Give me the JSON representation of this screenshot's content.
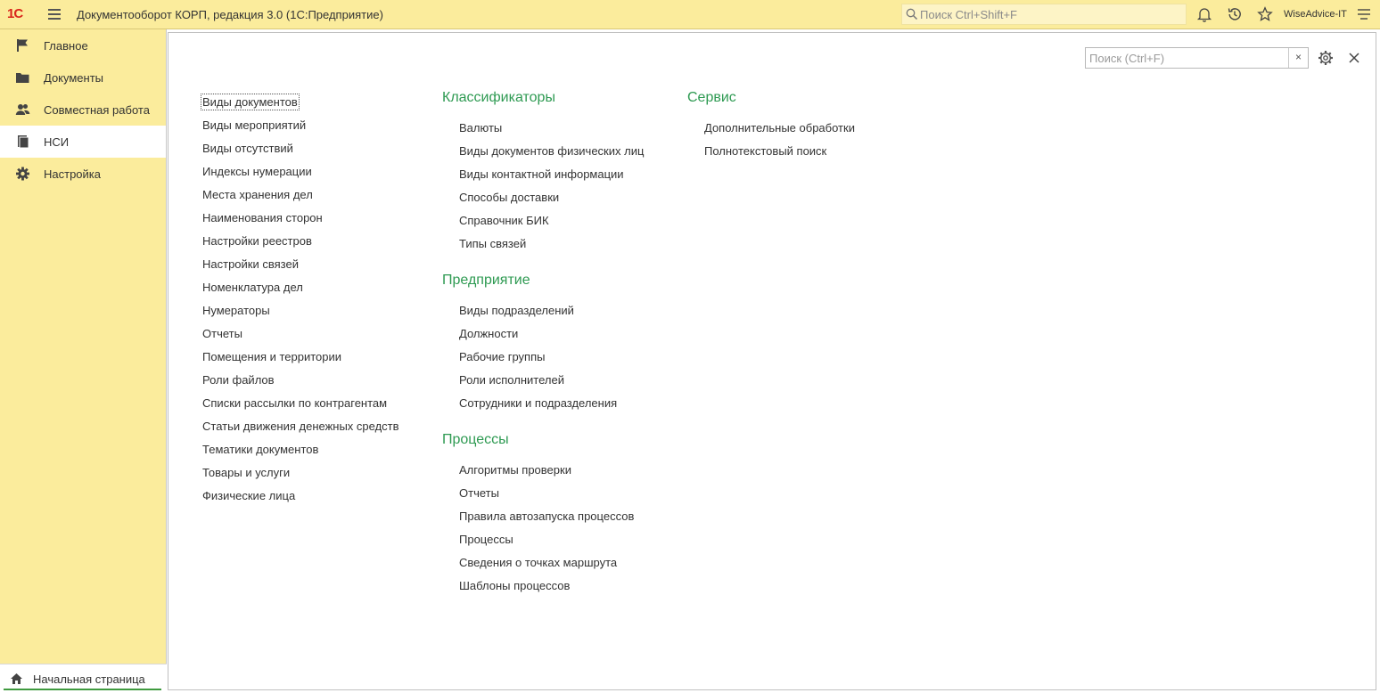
{
  "app": {
    "logo": "1С",
    "title": "Документооборот КОРП, редакция 3.0  (1С:Предприятие)",
    "search_placeholder": "Поиск Ctrl+Shift+F",
    "user": "WiseAdvice-IT"
  },
  "sidebar": {
    "items": [
      {
        "label": "Главное",
        "icon": "flag-icon"
      },
      {
        "label": "Документы",
        "icon": "folder-icon"
      },
      {
        "label": "Совместная работа",
        "icon": "users-icon"
      },
      {
        "label": "НСИ",
        "icon": "book-icon",
        "active": true
      },
      {
        "label": "Настройка",
        "icon": "gear-icon"
      }
    ],
    "home_tab": "Начальная страница"
  },
  "form": {
    "search_placeholder": "Поиск (Ctrl+F)",
    "clear_label": "×"
  },
  "columns": {
    "left": {
      "items": [
        "Виды документов",
        "Виды мероприятий",
        "Виды отсутствий",
        "Индексы нумерации",
        "Места хранения дел",
        "Наименования сторон",
        "Настройки реестров",
        "Настройки связей",
        "Номенклатура дел",
        "Нумераторы",
        "Отчеты",
        "Помещения и территории",
        "Роли файлов",
        "Списки рассылки по контрагентам",
        "Статьи движения денежных средств",
        "Тематики документов",
        "Товары и услуги",
        "Физические лица"
      ]
    },
    "middle": {
      "sections": [
        {
          "title": "Классификаторы",
          "items": [
            "Валюты",
            "Виды документов физических лиц",
            "Виды контактной информации",
            "Способы доставки",
            "Справочник БИК",
            "Типы связей"
          ]
        },
        {
          "title": "Предприятие",
          "items": [
            "Виды подразделений",
            "Должности",
            "Рабочие группы",
            "Роли исполнителей",
            "Сотрудники и подразделения"
          ]
        },
        {
          "title": "Процессы",
          "items": [
            "Алгоритмы проверки",
            "Отчеты",
            "Правила автозапуска процессов",
            "Процессы",
            "Сведения о точках маршрута",
            "Шаблоны процессов"
          ]
        }
      ]
    },
    "right": {
      "sections": [
        {
          "title": "Сервис",
          "items": [
            "Дополнительные обработки",
            "Полнотекстовый поиск"
          ]
        }
      ]
    }
  },
  "colors": {
    "panel_yellow": "#fbec9c",
    "section_green": "#2e9a52",
    "logo_red": "#d9261c"
  }
}
